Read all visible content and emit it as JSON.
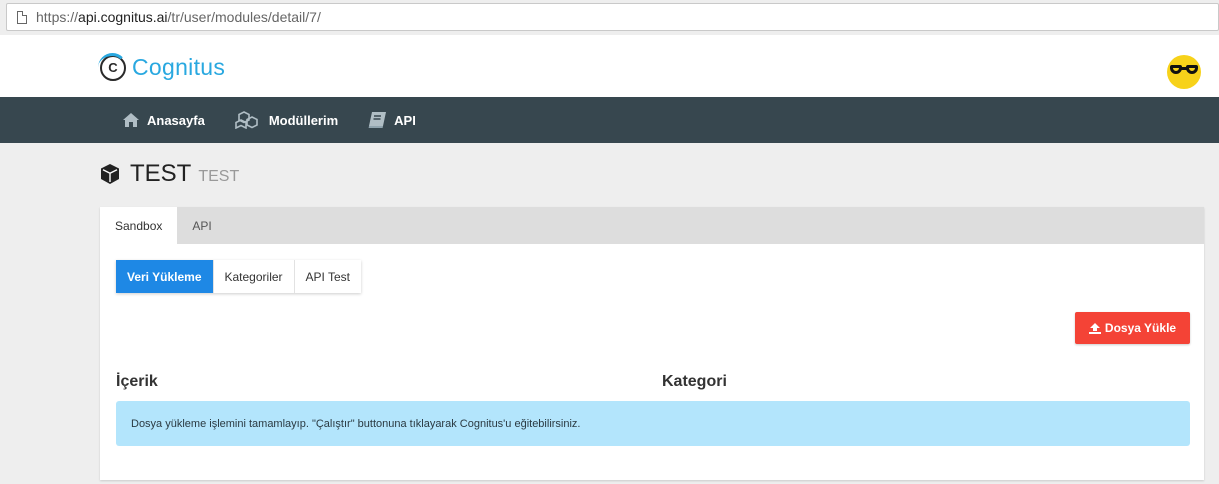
{
  "browser": {
    "url_scheme": "https://",
    "url_host": "api.cognitus.ai",
    "url_path": "/tr/user/modules/detail/7/"
  },
  "header": {
    "logo_mark": "C",
    "logo_text": "Cognitus",
    "avatar_icon": "sunglasses-emoji"
  },
  "nav": {
    "items": [
      {
        "label": "Anasayfa",
        "icon": "home-icon"
      },
      {
        "label": "Modüllerim",
        "icon": "cubes-icon"
      },
      {
        "label": "API",
        "icon": "book-icon"
      }
    ]
  },
  "page": {
    "title": "TEST",
    "subtitle": "TEST",
    "icon": "cube-icon"
  },
  "tabs": [
    {
      "label": "Sandbox",
      "active": true
    },
    {
      "label": "API",
      "active": false
    }
  ],
  "subtabs": [
    {
      "label": "Veri Yükleme",
      "active": true
    },
    {
      "label": "Kategoriler",
      "active": false
    },
    {
      "label": "API Test",
      "active": false
    }
  ],
  "actions": {
    "upload_label": "Dosya Yükle"
  },
  "table": {
    "columns": [
      "İçerik",
      "Kategori"
    ]
  },
  "alert": {
    "message": "Dosya yükleme işlemini tamamlayıp. \"Çalıştır\" buttonuna tıklayarak Cognitus'u eğitebilirsiniz."
  },
  "colors": {
    "navbar": "#37474f",
    "brand": "#29a8e0",
    "primary": "#1e88e5",
    "danger": "#f44336",
    "info_bg": "#b3e5fc"
  }
}
